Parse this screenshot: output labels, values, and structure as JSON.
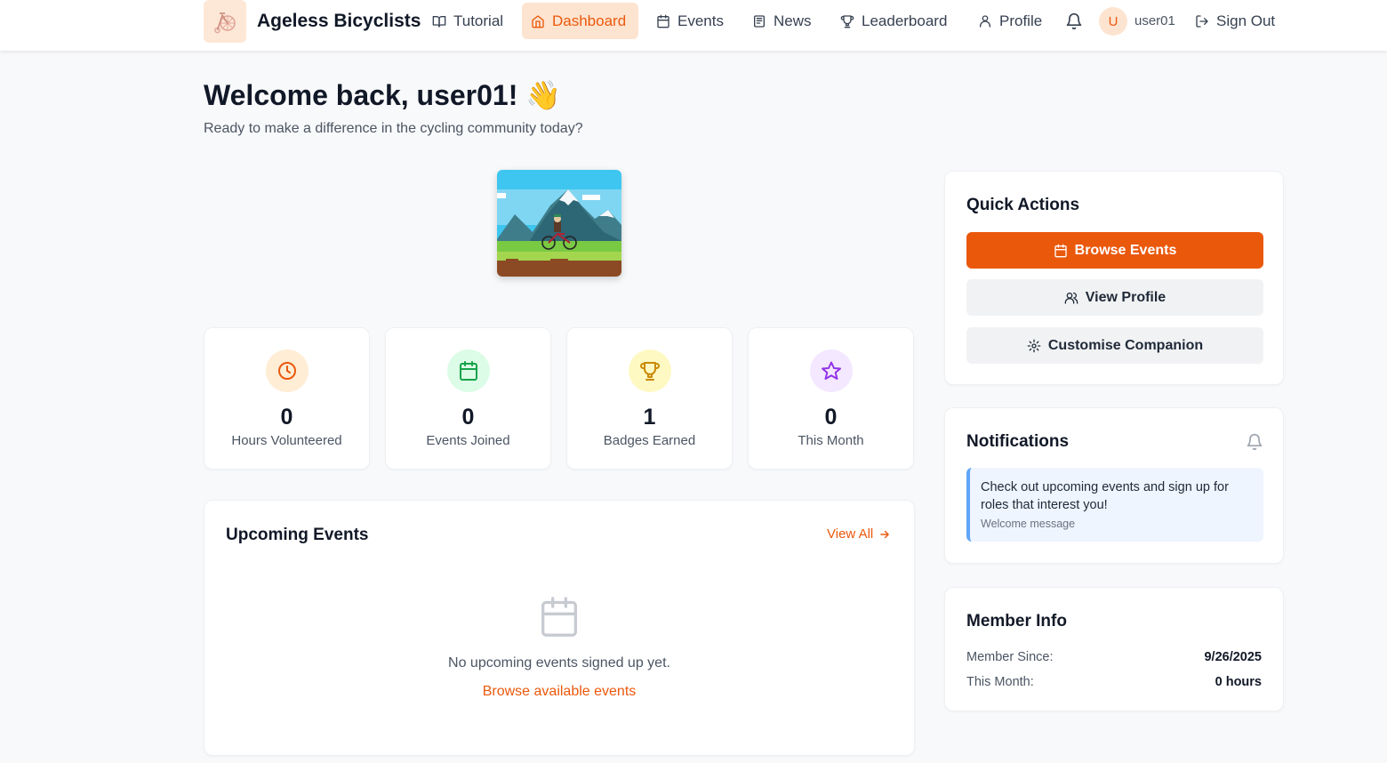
{
  "header": {
    "brand": "Ageless Bicyclists",
    "nav": [
      {
        "label": "Tutorial",
        "icon": "book-icon"
      },
      {
        "label": "Dashboard",
        "icon": "home-icon"
      },
      {
        "label": "Events",
        "icon": "calendar-icon"
      },
      {
        "label": "News",
        "icon": "newspaper-icon"
      },
      {
        "label": "Leaderboard",
        "icon": "trophy-icon"
      },
      {
        "label": "Profile",
        "icon": "user-icon"
      }
    ],
    "active_nav": "Dashboard",
    "avatar_initial": "U",
    "username": "user01",
    "sign_out": "Sign Out"
  },
  "welcome": {
    "title": "Welcome back, user01! 👋",
    "subtitle": "Ready to make a difference in the cycling community today?"
  },
  "stats": [
    {
      "value": "0",
      "label": "Hours Volunteered",
      "icon": "clock-icon",
      "color": "#ea580c",
      "bg": "#ffedd5"
    },
    {
      "value": "0",
      "label": "Events Joined",
      "icon": "calendar-icon",
      "color": "#16a34a",
      "bg": "#dcfce7"
    },
    {
      "value": "1",
      "label": "Badges Earned",
      "icon": "trophy-icon",
      "color": "#ca8a04",
      "bg": "#fef9c3"
    },
    {
      "value": "0",
      "label": "This Month",
      "icon": "star-icon",
      "color": "#9333ea",
      "bg": "#f3e8ff"
    }
  ],
  "upcoming": {
    "title": "Upcoming Events",
    "view_all": "View All",
    "empty_text": "No upcoming events signed up yet.",
    "browse_link": "Browse available events"
  },
  "quick_actions": {
    "title": "Quick Actions",
    "browse_events": "Browse Events",
    "view_profile": "View Profile",
    "customise": "Customise Companion"
  },
  "notifications": {
    "title": "Notifications",
    "message": "Check out upcoming events and sign up for roles that interest you!",
    "subtitle": "Welcome message"
  },
  "member_info": {
    "title": "Member Info",
    "member_since_label": "Member Since:",
    "member_since_value": "9/26/2025",
    "this_month_label": "This Month:",
    "this_month_value": "0 hours"
  },
  "colors": {
    "accent": "#ea580c",
    "accent_light": "#fde4d0",
    "info_blue": "#60a5fa"
  }
}
